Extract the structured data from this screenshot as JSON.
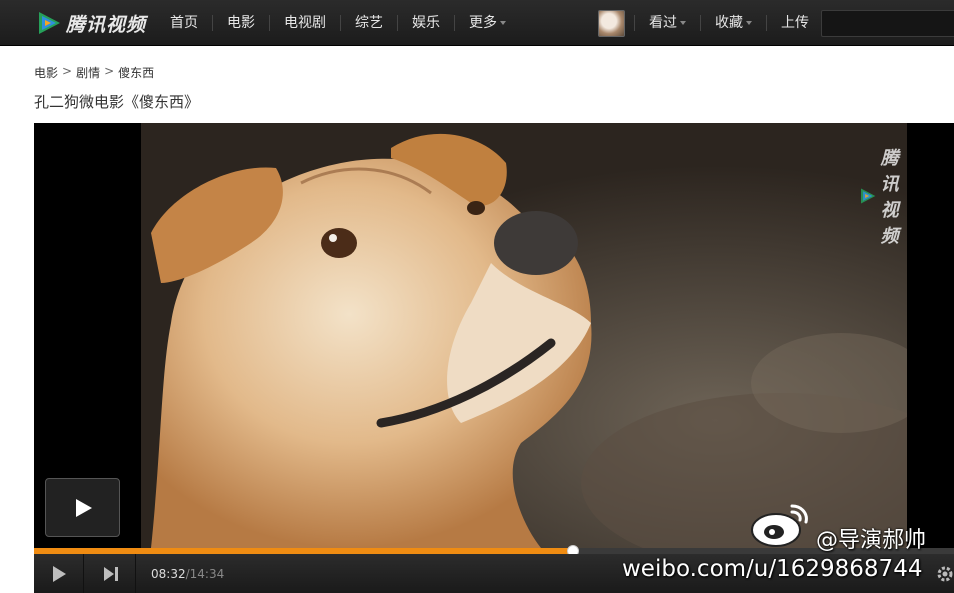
{
  "header": {
    "logo_text": "腾讯视频",
    "nav": [
      {
        "label": "首页"
      },
      {
        "label": "电影"
      },
      {
        "label": "电视剧"
      },
      {
        "label": "综艺"
      },
      {
        "label": "娱乐"
      },
      {
        "label": "更多"
      }
    ],
    "user_nav": [
      {
        "label": "看过"
      },
      {
        "label": "收藏"
      },
      {
        "label": "上传"
      }
    ],
    "search": {
      "placeholder": "",
      "value": ""
    }
  },
  "breadcrumb": [
    "电影",
    "剧情",
    "傻东西"
  ],
  "breadcrumb_separator": ">",
  "page_title": "孔二狗微电影《傻东西》",
  "player": {
    "watermark": "腾讯视频",
    "current_time": "08:32",
    "duration": "/14:34",
    "progress_fraction": 0.5858
  },
  "overlay": {
    "weibo_handle": "@导演郝帅",
    "weibo_url": "weibo.com/u/1629868744"
  },
  "colors": {
    "accent": "#f08c12",
    "topbar": "#1e1e1e",
    "logo_green": "#26a05a",
    "logo_blue": "#2f8fde",
    "logo_orange": "#f5a623"
  },
  "icons": [
    "tencent-video-logo-icon",
    "play-icon",
    "next-icon",
    "settings-icon",
    "weibo-icon"
  ]
}
